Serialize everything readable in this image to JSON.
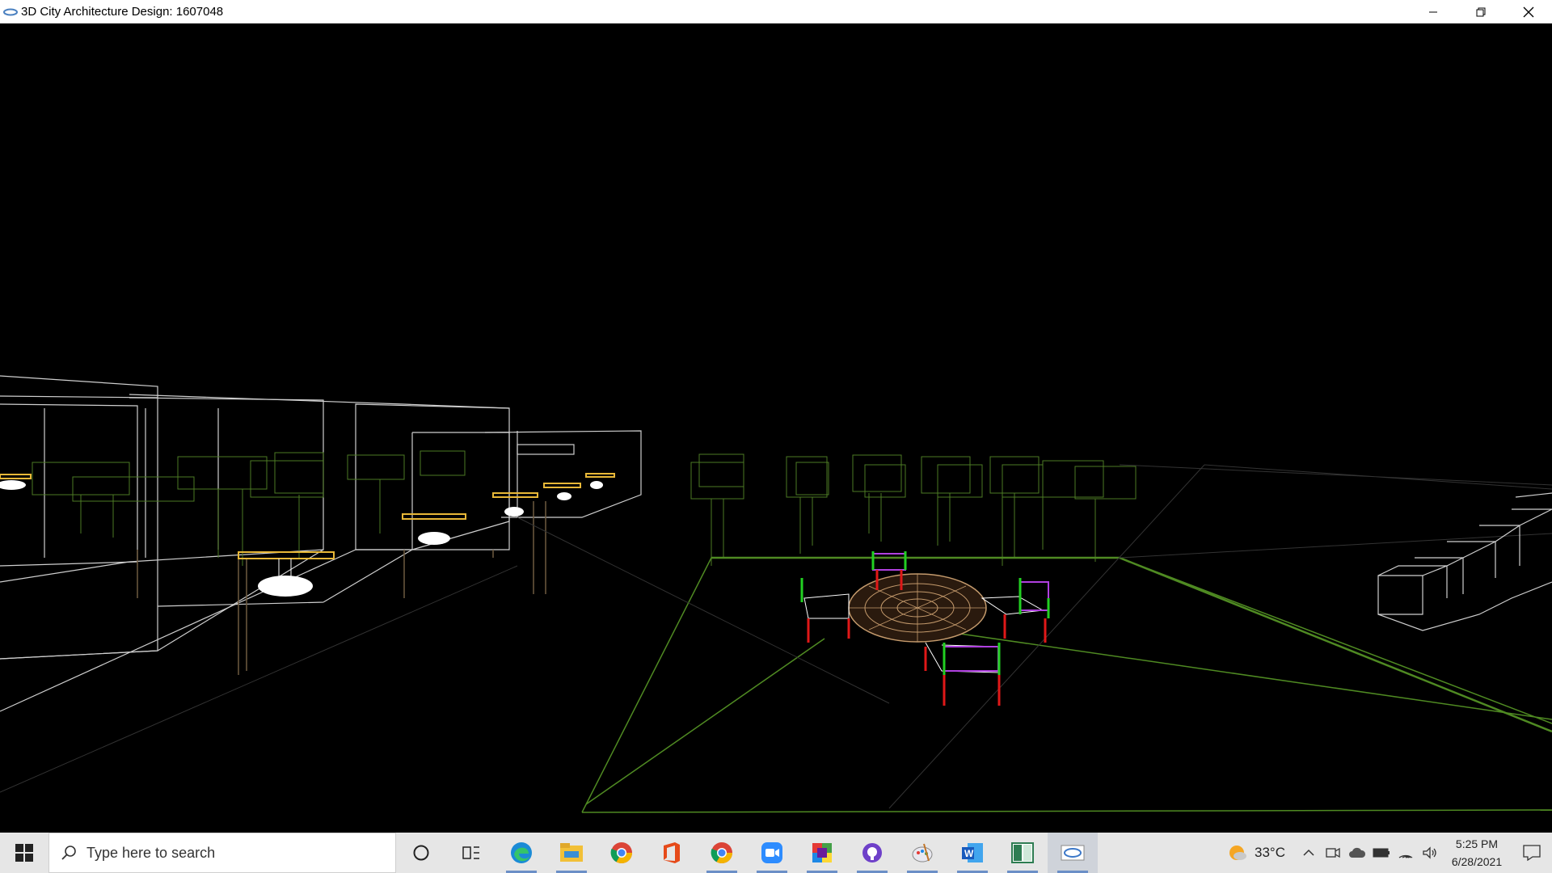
{
  "window": {
    "title": "3D City Architecture Design: 1607048"
  },
  "controls": {
    "minimize": "minimize-icon",
    "restore": "restore-icon",
    "close": "close-icon"
  },
  "taskbar": {
    "search_placeholder": "Type here to search",
    "pinned": [
      "cortana-icon",
      "task-view-icon",
      "edge-icon",
      "file-explorer-icon",
      "chrome-icon",
      "office-icon",
      "chrome-icon",
      "zoom-icon",
      "colorful-app-icon",
      "github-icon",
      "paint-icon",
      "word-icon",
      "app-window-icon",
      "opengl-app-icon"
    ],
    "weather": {
      "temp": "33°C"
    },
    "clock": {
      "time": "5:25 PM",
      "date": "6/28/2021"
    }
  },
  "colors": {
    "wire_white": "#d8d8d8",
    "wire_green": "#5a8f2a",
    "ground_green": "#4f8a22",
    "table_tan": "#c49a6c",
    "chair_red": "#e01818",
    "chair_green": "#22d022",
    "chair_purple": "#b040e0",
    "lamp_yellow": "#e8b838"
  }
}
